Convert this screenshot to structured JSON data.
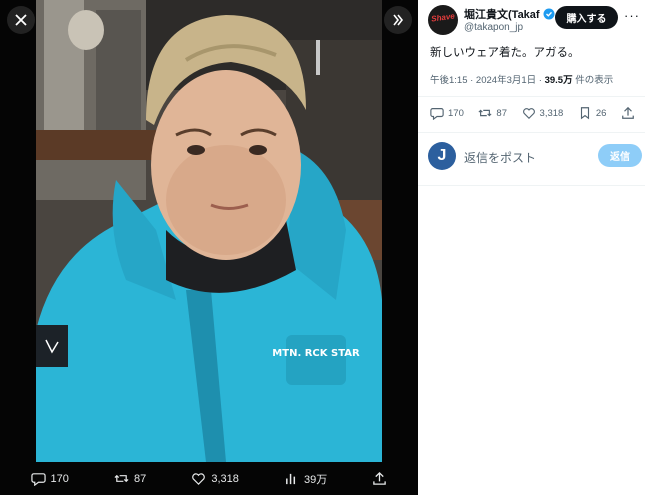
{
  "viewer": {
    "close_icon": "close-icon",
    "expand_icon": "expand-icon",
    "photo": {
      "jacket_logo": "MTN. RCK STAR"
    },
    "media_bar": {
      "replies": "170",
      "reposts": "87",
      "likes": "3,318",
      "views": "39万"
    }
  },
  "panel": {
    "author": {
      "name": "堀江貴文(Takaf",
      "handle": "@takapon_jp",
      "avatar_text": "Shave"
    },
    "buy_label": "購入する",
    "more_label": "···",
    "tweet": {
      "text": "新しいウェア着た。アガる。",
      "time": "午後1:15 · 2024年3月1日 · ",
      "views": "39.5万",
      "views_suffix": " 件の表示"
    },
    "actions": {
      "replies": "170",
      "reposts": "87",
      "likes": "3,318",
      "bookmarks": "26"
    },
    "reply": {
      "avatar_letter": "J",
      "placeholder": "返信をポスト",
      "button": "返信"
    }
  },
  "colors": {
    "jacket": "#2bb5d6",
    "reply_button": "#8ecdf8",
    "verified": "#1d9bf0"
  }
}
